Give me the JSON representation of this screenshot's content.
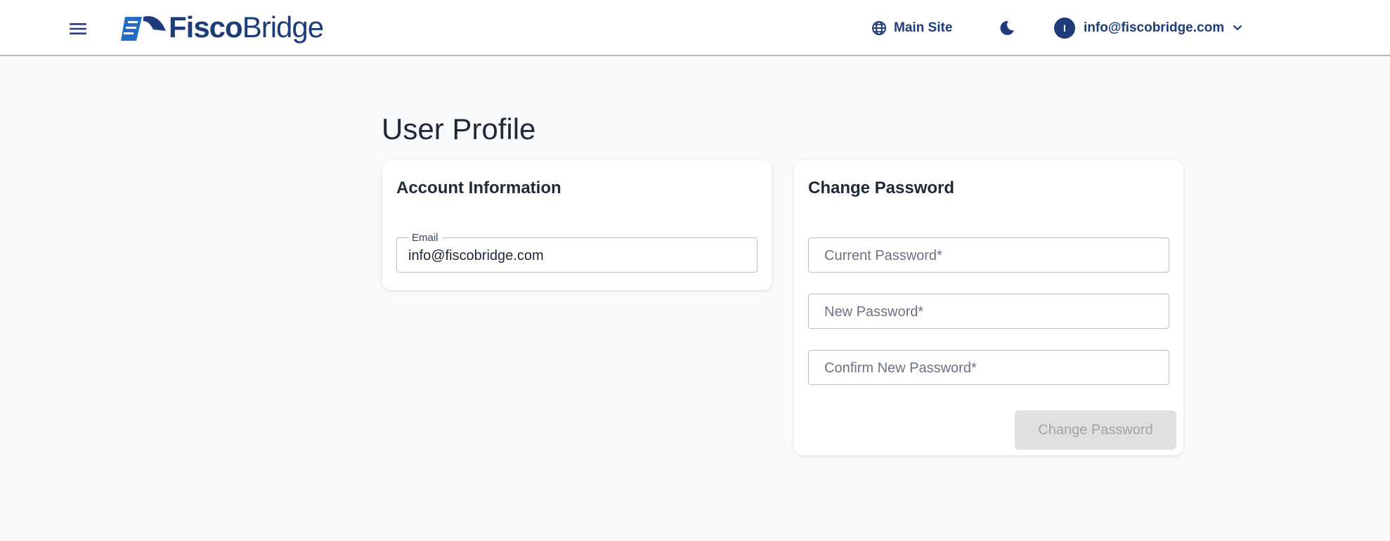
{
  "header": {
    "logo_bold": "Fisco",
    "logo_light": "Bridge",
    "main_site_label": "Main Site",
    "user_initial": "I",
    "user_email": "info@fiscobridge.com",
    "brand_color": "#1f3c7a",
    "accent_color": "#1f6fc4",
    "icons": [
      "menu-icon",
      "globe-icon",
      "moon-icon",
      "chevron-down-icon"
    ]
  },
  "page": {
    "title": "User Profile"
  },
  "account": {
    "title": "Account Information",
    "email_label": "Email",
    "email_value": "info@fiscobridge.com"
  },
  "password": {
    "title": "Change Password",
    "current_placeholder": "Current Password*",
    "new_placeholder": "New Password*",
    "confirm_placeholder": "Confirm New Password*",
    "submit_label": "Change Password"
  }
}
